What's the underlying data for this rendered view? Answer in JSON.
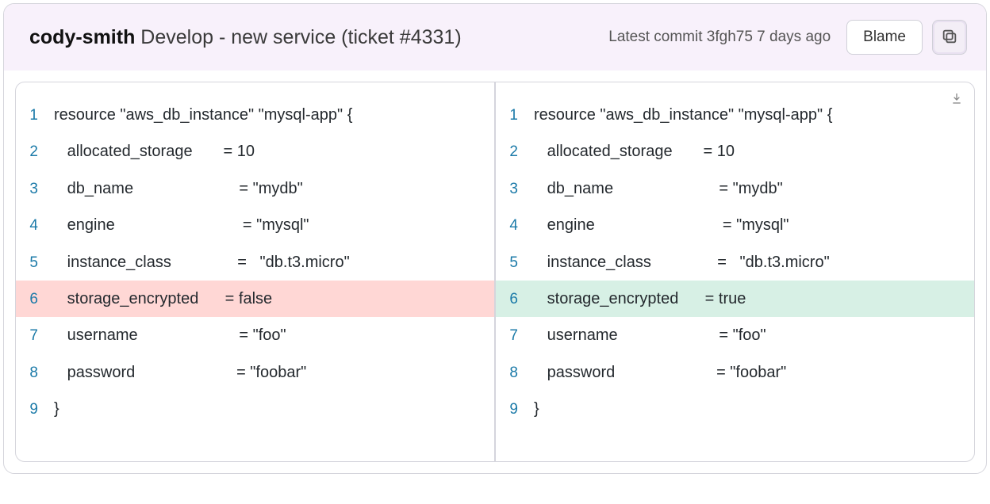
{
  "header": {
    "author": "cody-smith",
    "title_rest": " Develop - new service (ticket #4331)",
    "commit_info": "Latest commit 3fgh75 7 days ago",
    "blame_label": "Blame"
  },
  "diff": {
    "left": [
      {
        "n": "1",
        "text": "resource \"aws_db_instance\" \"mysql-app\" {",
        "kind": ""
      },
      {
        "n": "2",
        "text": "   allocated_storage       = 10",
        "kind": ""
      },
      {
        "n": "3",
        "text": "   db_name                        = \"mydb\"",
        "kind": ""
      },
      {
        "n": "4",
        "text": "   engine                             = \"mysql\"",
        "kind": ""
      },
      {
        "n": "5",
        "text": "   instance_class               =   \"db.t3.micro\"",
        "kind": ""
      },
      {
        "n": "6",
        "text": "   storage_encrypted      = false",
        "kind": "removed"
      },
      {
        "n": "7",
        "text": "   username                       = \"foo\"",
        "kind": ""
      },
      {
        "n": "8",
        "text": "   password                       = \"foobar\"",
        "kind": ""
      },
      {
        "n": "9",
        "text": "}",
        "kind": ""
      }
    ],
    "right": [
      {
        "n": "1",
        "text": "resource \"aws_db_instance\" \"mysql-app\" {",
        "kind": ""
      },
      {
        "n": "2",
        "text": "   allocated_storage       = 10",
        "kind": ""
      },
      {
        "n": "3",
        "text": "   db_name                        = \"mydb\"",
        "kind": ""
      },
      {
        "n": "4",
        "text": "   engine                             = \"mysql\"",
        "kind": ""
      },
      {
        "n": "5",
        "text": "   instance_class               =   \"db.t3.micro\"",
        "kind": ""
      },
      {
        "n": "6",
        "text": "   storage_encrypted      = true",
        "kind": "added"
      },
      {
        "n": "7",
        "text": "   username                       = \"foo\"",
        "kind": ""
      },
      {
        "n": "8",
        "text": "   password                       = \"foobar\"",
        "kind": ""
      },
      {
        "n": "9",
        "text": "}",
        "kind": ""
      }
    ]
  }
}
